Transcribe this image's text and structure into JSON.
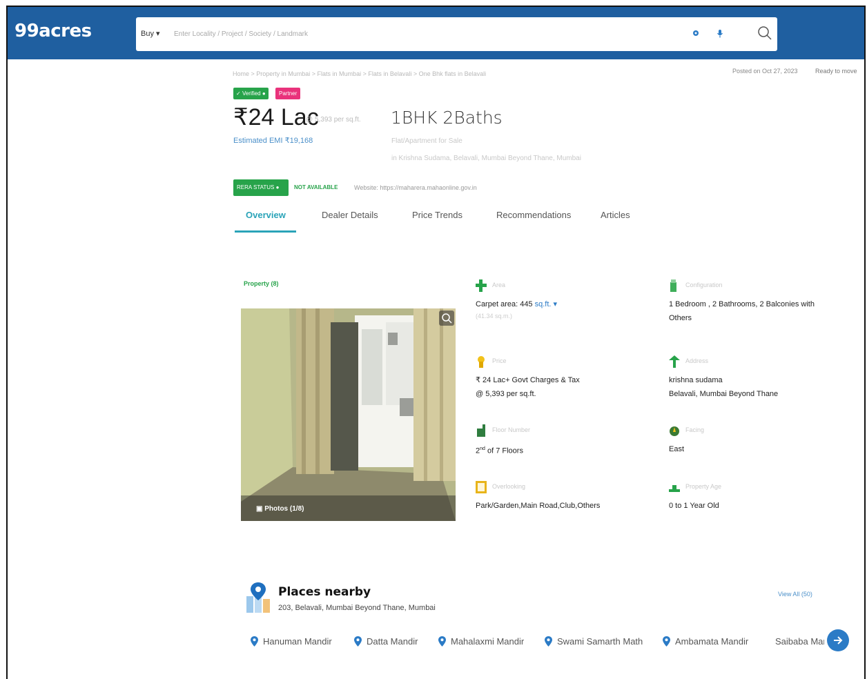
{
  "header": {
    "logo": "99acres",
    "buy_dropdown": "Buy",
    "search_placeholder": "Enter Locality / Project / Society / Landmark"
  },
  "breadcrumb": "Home > Property in Mumbai > Flats in Mumbai > Flats in Belavali > One Bhk flats in Belavali",
  "posted_on": "Posted on Oct 27, 2023",
  "possession": "Ready to move",
  "badges": {
    "verified": "Verified",
    "partner": "Partner"
  },
  "price": "₹24 Lac",
  "price_per_sqft": "@ 5,393 per sq.ft.",
  "title": "1BHK 2Baths",
  "emi": "Estimated EMI ₹19,168",
  "subtitle_type": "Flat/Apartment for Sale",
  "subtitle_location": "in Krishna Sudama, Belavali, Mumbai Beyond Thane, Mumbai",
  "rera": {
    "status_label": "RERA STATUS",
    "status_value": "NOT AVAILABLE",
    "website": "Website: https://maharera.mahaonline.gov.in"
  },
  "tabs": [
    {
      "label": "Overview"
    },
    {
      "label": "Dealer Details"
    },
    {
      "label": "Price Trends"
    },
    {
      "label": "Recommendations"
    },
    {
      "label": "Articles"
    }
  ],
  "photos": {
    "section_label": "Property (8)",
    "caption": "Photos (1/8)"
  },
  "details": {
    "area": {
      "label": "Area",
      "value": "Carpet area: 445",
      "unit": "sq.ft.",
      "sub": "(41.34 sq.m.)"
    },
    "configuration": {
      "label": "Configuration",
      "value": "1 Bedroom , 2 Bathrooms, 2 Balconies with Others"
    },
    "price": {
      "label": "Price",
      "value": "₹ 24 Lac+ Govt Charges & Tax",
      "value2": "@ 5,393 per sq.ft."
    },
    "address": {
      "label": "Address",
      "value": "krishna sudama",
      "value2": "Belavali, Mumbai Beyond Thane"
    },
    "floor": {
      "label": "Floor Number",
      "value": "2",
      "sup": "nd",
      "value_rest": " of 7 Floors"
    },
    "facing": {
      "label": "Facing",
      "value": "East"
    },
    "overlooking": {
      "label": "Overlooking",
      "value": "Park/Garden,Main Road,Club,Others"
    },
    "age": {
      "label": "Property Age",
      "value": "0 to 1 Year Old"
    }
  },
  "nearby": {
    "title": "Places nearby",
    "address": "203, Belavali, Mumbai Beyond Thane, Mumbai",
    "view_all": "View All (50)",
    "places": [
      {
        "name": "Hanuman Mandir"
      },
      {
        "name": "Datta Mandir"
      },
      {
        "name": "Mahalaxmi Mandir"
      },
      {
        "name": "Swami Samarth Math"
      },
      {
        "name": "Ambamata Mandir"
      },
      {
        "name": "Saibaba Mandir"
      }
    ]
  },
  "colors": {
    "brand_blue": "#1f5fa0",
    "green": "#27a34a",
    "teal_active": "#2aa3b8",
    "pink": "#e9327b",
    "link_blue": "#2b7bc6"
  }
}
